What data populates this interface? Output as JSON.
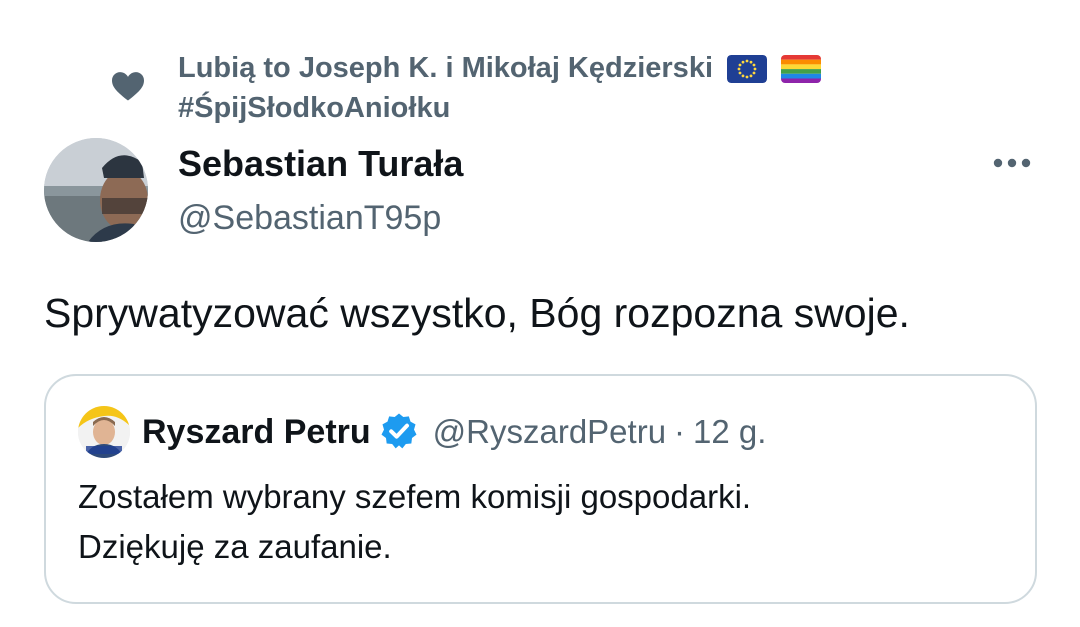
{
  "social_context": {
    "text": "Lubią to Joseph K. i Mikołaj Kędzierski",
    "hashtag": "#ŚpijSłodkoAniołku",
    "flags": [
      "eu-flag-icon",
      "rainbow-flag-icon"
    ],
    "color": "#536471"
  },
  "author": {
    "name": "Sebastian Turała",
    "handle": "@SebastianT95p"
  },
  "tweet": {
    "text": "Sprywatyzować wszystko, Bóg rozpozna swoje."
  },
  "quoted": {
    "name": "Ryszard Petru",
    "handle": "@RyszardPetru",
    "separator": "·",
    "time": "12 g.",
    "text_line1": "Zostałem wybrany szefem komisji gospodarki.",
    "text_line2": "Dziękuję za zaufanie.",
    "verified_color": "#1d9bf0"
  },
  "colors": {
    "text": "#0f1419",
    "secondary": "#536471",
    "border": "#cfd9de"
  }
}
